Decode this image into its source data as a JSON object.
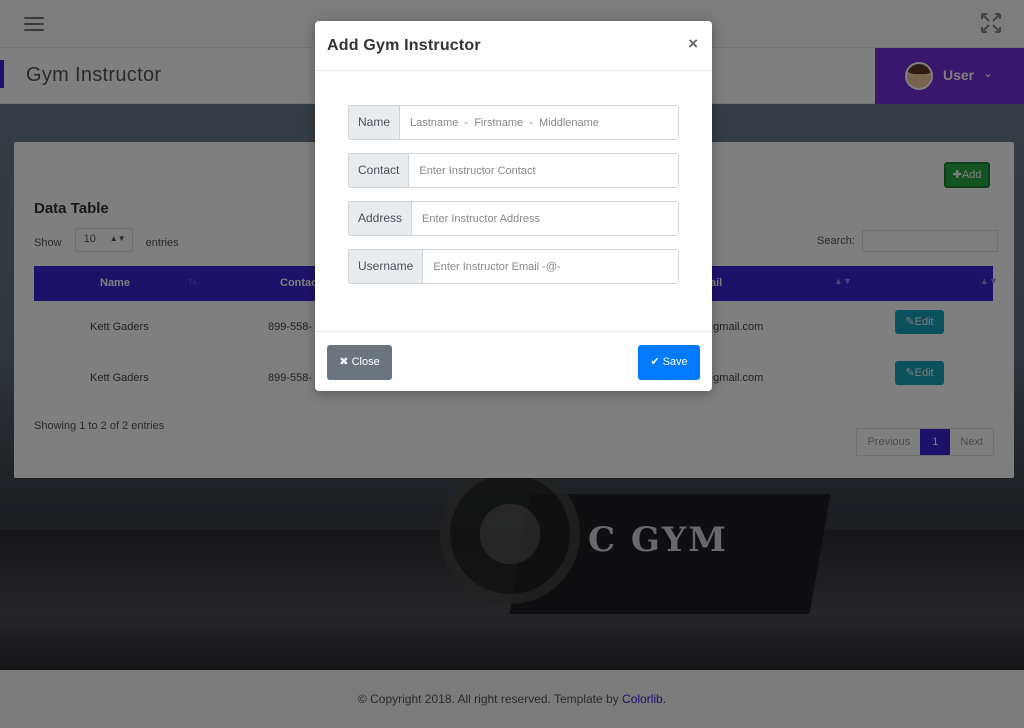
{
  "header": {
    "page_title": "Gym Instructor",
    "user_label": "User",
    "accent_color": "#3a24d4",
    "user_bg_color": "#6f2cd8"
  },
  "hero": {
    "sign_text": "C GYM"
  },
  "card": {
    "add_label": "Add",
    "section_title": "Data Table",
    "show_label": "Show",
    "entries_value": "10",
    "entries_label": "entries",
    "search_label": "Search:",
    "columns": [
      "Name",
      "Contac",
      "ail"
    ],
    "rows": [
      {
        "name": "Kett Gaders",
        "contact": "899-558-",
        "email": "@gmail.com",
        "edit_label": "Edit"
      },
      {
        "name": "Kett Gaders",
        "contact": "899-558-",
        "email": "@gmail.com",
        "edit_label": "Edit"
      }
    ],
    "showing_text": "Showing 1 to 2 of 2 entries",
    "pager": {
      "previous": "Previous",
      "current": "1",
      "next": "Next"
    }
  },
  "footer": {
    "text": "© Copyright 2018. All right reserved. Template by ",
    "link": "Colorlib",
    "end": "."
  },
  "modal": {
    "title": "Add Gym Instructor",
    "close_symbol": "×",
    "fields": {
      "name_label": "Name",
      "name_placeholder": "Lastname  -  Firstname  -  Middlename",
      "contact_label": "Contact",
      "contact_placeholder": "Enter Instructor Contact",
      "address_label": "Address",
      "address_placeholder": "Enter Instructor Address",
      "username_label": "Username",
      "username_placeholder": "Enter Instructor Email -@-"
    },
    "close_label": "Close",
    "save_label": "Save"
  }
}
